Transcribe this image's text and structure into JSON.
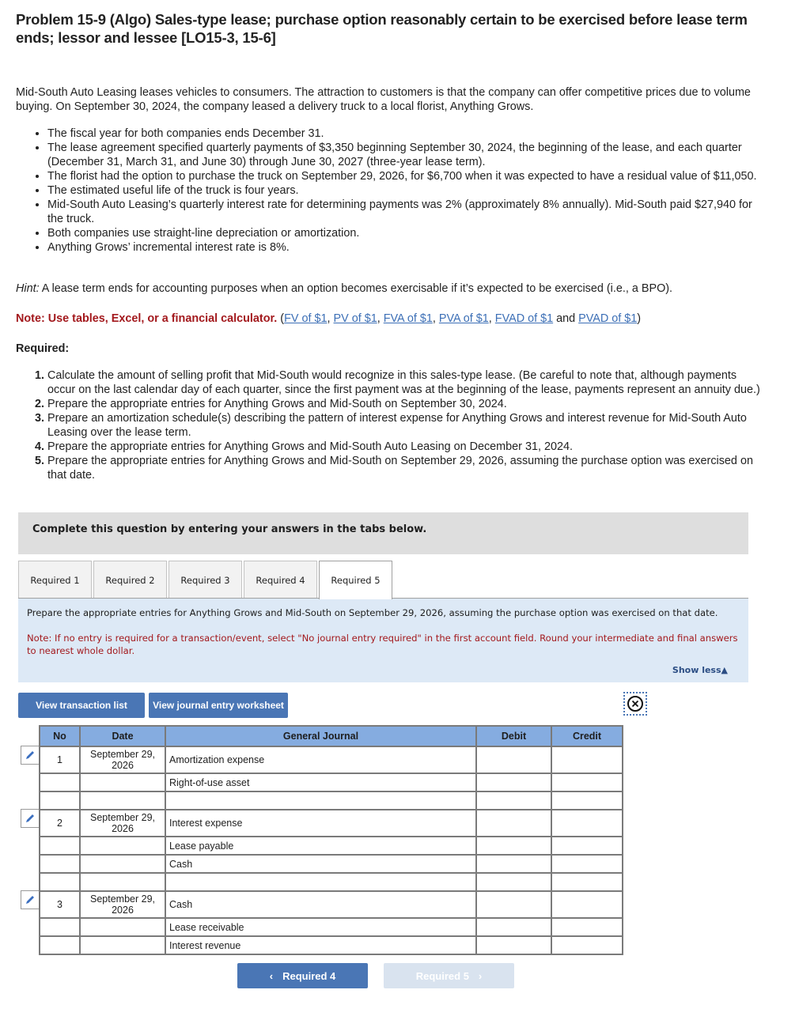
{
  "problem": {
    "title": "Problem 15-9 (Algo) Sales-type lease; purchase option reasonably certain to be exercised before lease term ends; lessor and lessee [LO15-3, 15-6]",
    "intro": "Mid-South Auto Leasing leases vehicles to consumers. The attraction to customers is that the company can offer competitive prices due to volume buying. On September 30, 2024, the company leased a delivery truck to a local florist, Anything Grows.",
    "bullets": [
      "The fiscal year for both companies ends December 31.",
      "The lease agreement specified quarterly payments of $3,350 beginning September 30, 2024, the beginning of the lease, and each quarter (December 31, March 31, and June 30) through June 30, 2027 (three-year lease term).",
      "The florist had the option to purchase the truck on September 29, 2026, for $6,700 when it was expected to have a residual value of $11,050.",
      "The estimated useful life of the truck is four years.",
      "Mid-South Auto Leasing’s quarterly interest rate for determining payments was 2% (approximately 8% annually). Mid-South paid $27,940 for the truck.",
      "Both companies use straight-line depreciation or amortization.",
      "Anything Grows’ incremental interest rate is 8%."
    ],
    "hint_label": "Hint:",
    "hint_text": " A lease term ends for accounting purposes when an option becomes exercisable if it’s expected to be exercised (i.e., a BPO).",
    "note_label": "Note: Use tables, Excel, or a financial calculator.",
    "note_links": [
      "FV of $1",
      "PV of $1",
      "FVA of $1",
      "PVA of $1",
      "FVAD of $1",
      "PVAD of $1"
    ],
    "note_and": "and",
    "required_heading": "Required:",
    "requirements": [
      "Calculate the amount of selling profit that Mid-South would recognize in this sales-type lease. (Be careful to note that, although payments occur on the last calendar day of each quarter, since the first payment was at the beginning of the lease, payments represent an annuity due.)",
      "Prepare the appropriate entries for Anything Grows and Mid-South on September 30, 2024.",
      "Prepare an amortization schedule(s) describing the pattern of interest expense for Anything Grows and interest revenue for Mid-South Auto Leasing over the lease term.",
      "Prepare the appropriate entries for Anything Grows and Mid-South Auto Leasing on December 31, 2024.",
      "Prepare the appropriate entries for Anything Grows and Mid-South on September 29, 2026, assuming the purchase option was exercised on that date."
    ]
  },
  "question_box": {
    "text": "Complete this question by entering your answers in the tabs below."
  },
  "tabs": [
    {
      "label": "Required 1",
      "active": false
    },
    {
      "label": "Required 2",
      "active": false
    },
    {
      "label": "Required 3",
      "active": false
    },
    {
      "label": "Required 4",
      "active": false
    },
    {
      "label": "Required 5",
      "active": true
    }
  ],
  "instructions": {
    "text": "Prepare the appropriate entries for Anything Grows and Mid-South on September 29, 2026, assuming the purchase option was exercised on that date.",
    "note": "Note: If no entry is required for a transaction/event, select \"No journal entry required\" in the first account field. Round your intermediate and final answers to nearest whole dollar.",
    "show_less": "Show less"
  },
  "buttons": {
    "view_transaction_list": "View transaction list",
    "view_journal_worksheet": "View journal entry worksheet"
  },
  "journal": {
    "headers": {
      "no": "No",
      "date": "Date",
      "account": "General Journal",
      "debit": "Debit",
      "credit": "Credit"
    },
    "rows": [
      {
        "no": "1",
        "date": "September 29, 2026",
        "account": "Amortization expense",
        "debit": "",
        "credit": "",
        "tall": true
      },
      {
        "no": "",
        "date": "",
        "account": "Right-of-use asset",
        "debit": "",
        "credit": ""
      },
      {
        "no": "",
        "date": "",
        "account": "",
        "debit": "",
        "credit": ""
      },
      {
        "no": "2",
        "date": "September 29, 2026",
        "account": "Interest expense",
        "debit": "",
        "credit": "",
        "tall": true
      },
      {
        "no": "",
        "date": "",
        "account": "Lease payable",
        "debit": "",
        "credit": ""
      },
      {
        "no": "",
        "date": "",
        "account": "Cash",
        "debit": "",
        "credit": ""
      },
      {
        "no": "",
        "date": "",
        "account": "",
        "debit": "",
        "credit": ""
      },
      {
        "no": "3",
        "date": "September 29, 2026",
        "account": "Cash",
        "debit": "",
        "credit": "",
        "tall": true
      },
      {
        "no": "",
        "date": "",
        "account": "Lease receivable",
        "debit": "",
        "credit": ""
      },
      {
        "no": "",
        "date": "",
        "account": "Interest revenue",
        "debit": "",
        "credit": ""
      }
    ]
  },
  "navigation": {
    "prev_label": "Required 4",
    "next_label": "Required 5"
  },
  "colors": {
    "accent_blue": "#4a76b5",
    "header_blue": "#85ace0",
    "note_red": "#a3191d",
    "link_blue": "#3c6fb6",
    "panel_blue": "#dde9f6"
  }
}
